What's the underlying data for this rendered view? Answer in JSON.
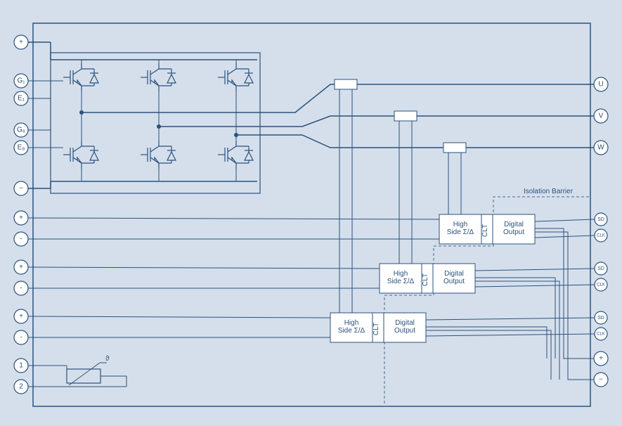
{
  "pins_left": [
    {
      "id": "plus-top",
      "label": "+"
    },
    {
      "id": "g1",
      "label": "G₁"
    },
    {
      "id": "e1",
      "label": "E₁"
    },
    {
      "id": "g8",
      "label": "G₈"
    },
    {
      "id": "e8",
      "label": "E₈"
    },
    {
      "id": "minus-top",
      "label": "−"
    },
    {
      "id": "plus-a",
      "label": "+"
    },
    {
      "id": "minus-a",
      "label": "-"
    },
    {
      "id": "plus-b",
      "label": "+"
    },
    {
      "id": "minus-b",
      "label": "-"
    },
    {
      "id": "plus-c",
      "label": "+"
    },
    {
      "id": "minus-c",
      "label": "-"
    },
    {
      "id": "t1",
      "label": "1"
    },
    {
      "id": "t2",
      "label": "2"
    }
  ],
  "pins_right": [
    {
      "id": "u",
      "label": "U"
    },
    {
      "id": "v",
      "label": "V"
    },
    {
      "id": "w",
      "label": "W"
    },
    {
      "id": "sd1",
      "label": "SD"
    },
    {
      "id": "clk1",
      "label": "CLK"
    },
    {
      "id": "sd2",
      "label": "SD"
    },
    {
      "id": "clk2",
      "label": "CLK"
    },
    {
      "id": "sd3",
      "label": "SD"
    },
    {
      "id": "clk3",
      "label": "CLK"
    },
    {
      "id": "plus-r",
      "label": "+"
    },
    {
      "id": "minus-r",
      "label": "−"
    }
  ],
  "isolation_label": "Isolation Barrier",
  "adc": {
    "high_side": "High\nSide Σ/Δ",
    "clt": "CLT",
    "digital_out": "Digital\nOutput"
  },
  "therm_theta": "ϑ"
}
